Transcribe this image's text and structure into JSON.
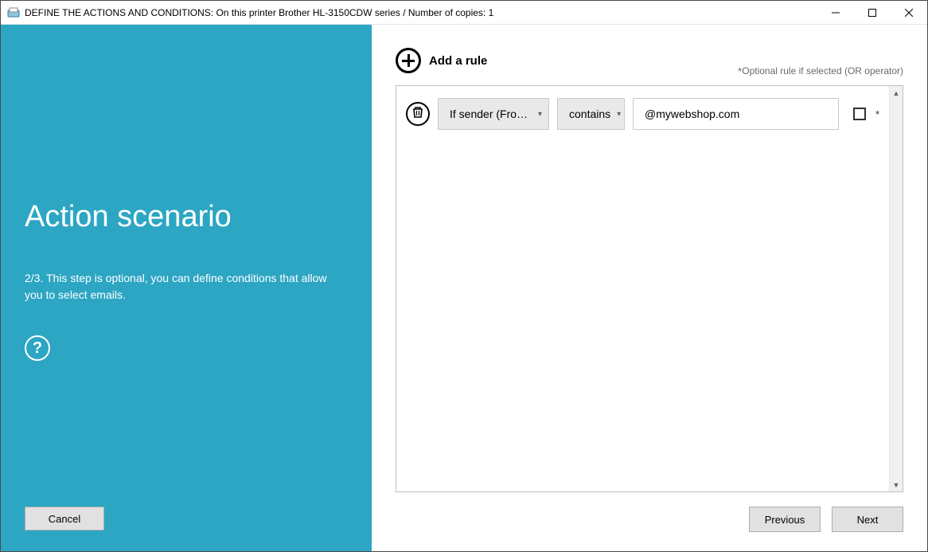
{
  "window": {
    "title": "DEFINE THE ACTIONS AND CONDITIONS: On this printer Brother HL-3150CDW series / Number of copies: 1"
  },
  "sidebar": {
    "heading": "Action scenario",
    "description": "2/3. This step is optional, you can define conditions that allow you to select emails.",
    "help_label": "?",
    "cancel_label": "Cancel"
  },
  "main": {
    "add_rule_label": "Add a rule",
    "optional_hint_prefix": "*",
    "optional_hint": "Optional rule if selected (OR operator)",
    "rules": [
      {
        "field_label": "If sender (From)...",
        "operator_label": "contains",
        "value": "@mywebshop.com",
        "optional_marker": "*"
      }
    ],
    "previous_label": "Previous",
    "next_label": "Next"
  }
}
